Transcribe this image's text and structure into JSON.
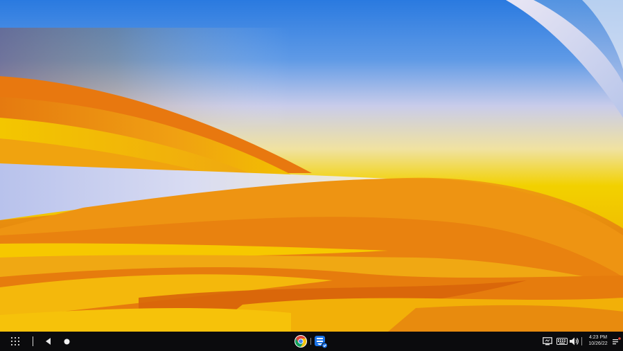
{
  "shelf": {
    "launcher_icon": "launcher-grid-icon",
    "back_icon": "back-arrow-icon",
    "home_icon": "home-dot-icon",
    "pinned_apps": [
      {
        "name": "chrome-icon"
      },
      {
        "name": "app-icon"
      }
    ],
    "tray": {
      "screen_icon": "screen-capture-icon",
      "keyboard_icon": "keyboard-icon",
      "volume_icon": "volume-icon",
      "time": "4:23 PM",
      "date": "10/26/22",
      "notification_icon": "notification-icon"
    }
  },
  "colors": {
    "sky_blue": "#2f7fdc",
    "lavender": "#c7cdee",
    "yellow": "#f2d400",
    "orange": "#ee9a12",
    "deep_orange": "#d8650a",
    "shelf": "#0b0b0d",
    "accent_blue": "#1a73e8"
  }
}
